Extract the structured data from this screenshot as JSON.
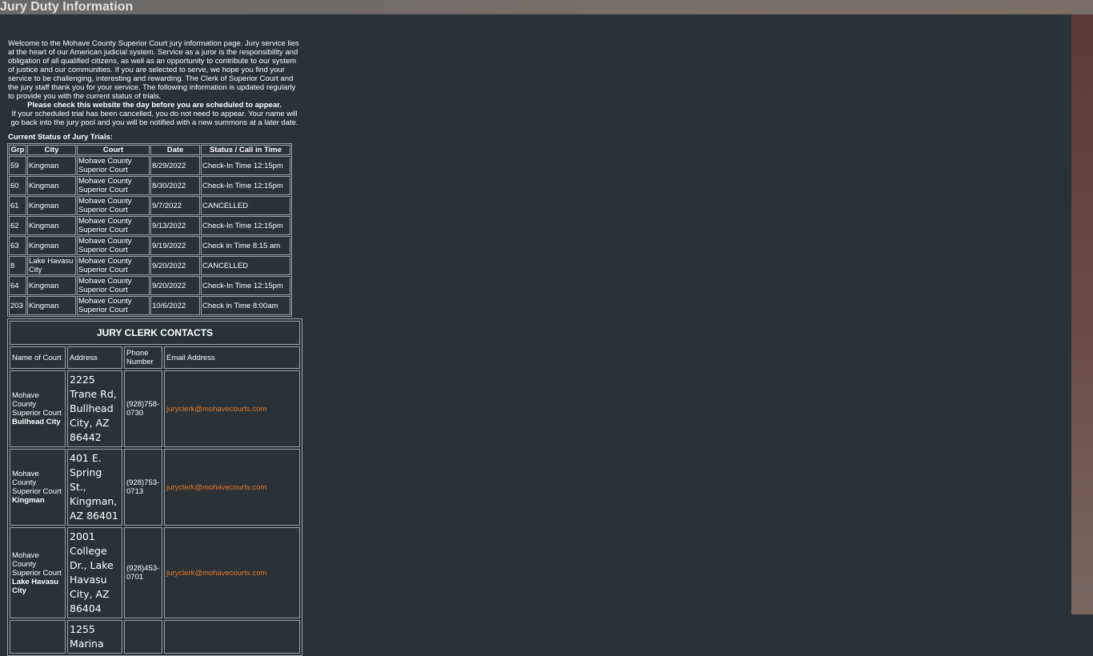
{
  "page": {
    "title": "Jury Duty Information"
  },
  "intro": "Welcome to the Mohave County Superior Court jury information page. Jury service lies at the heart of our American judicial system. Service as a juror is the responsibility and obligation of all qualified citizens, as well as an opportunity to contribute to our system of justice and our communities. If you are selected to serve, we hope you find your service to be challenging, interesting and rewarding. The Clerk of Superior Court and the jury staff thank you for your service. The following information is updated regularly to provide you with the current status of trials.",
  "notice": {
    "bold": "Please check this website the day before you are scheduled to appear.",
    "text": "If your scheduled trial has been cancelled, you do not need to appear. Your name will go back into the jury pool and you will be notified with a new summons at a later date."
  },
  "status_label": "Current Status of Jury Trials:",
  "trials": {
    "headers": [
      "Grp",
      "City",
      "Court",
      "Date",
      "Status / Call in Time"
    ],
    "rows": [
      [
        "59",
        "Kingman",
        "Mohave County Superior Court",
        "8/29/2022",
        "Check-In Time 12:15pm"
      ],
      [
        "60",
        "Kingman",
        "Mohave County Superior Court",
        "8/30/2022",
        "Check-In Time 12:15pm"
      ],
      [
        "61",
        "Kingman",
        "Mohave County Superior Court",
        "9/7/2022",
        "CANCELLED"
      ],
      [
        "62",
        "Kingman",
        "Mohave County Superior Court",
        "9/13/2022",
        "Check-In Time 12:15pm"
      ],
      [
        "63",
        "Kingman",
        "Mohave County Superior Court",
        "9/19/2022",
        "Check in Time 8:15 am"
      ],
      [
        "8",
        "Lake Havasu City",
        "Mohave County Superior Court",
        "9/20/2022",
        "CANCELLED"
      ],
      [
        "64",
        "Kingman",
        "Mohave County Superior Court",
        "9/20/2022",
        "Check-In Time 12:15pm"
      ],
      [
        "203",
        "Kingman",
        "Mohave County Superior Court",
        "10/6/2022",
        "Check in Time 8:00am"
      ]
    ]
  },
  "contacts": {
    "heading": "JURY CLERK CONTACTS",
    "headers": [
      "Name of Court",
      "Address",
      "Phone Number",
      "Email Address"
    ],
    "rows": [
      {
        "court": "Mohave County Superior Court",
        "city": "Bullhead City",
        "address": "2225 Trane Rd, Bullhead City, AZ 86442",
        "phone": "(928)758-0730",
        "email": "juryclerk@mohavecourts.com"
      },
      {
        "court": "Mohave County Superior Court",
        "city": "Kingman",
        "address": "401 E. Spring St., Kingman, AZ 86401",
        "phone": "(928)753-0713",
        "email": "juryclerk@mohavecourts.com"
      },
      {
        "court": "Mohave County Superior Court",
        "city": "Lake Havasu City",
        "address": "2001 College Dr., Lake Havasu City, AZ 86404",
        "phone": "(928)453-0701",
        "email": "juryclerk@mohavecourts.com"
      },
      {
        "court": "",
        "city": "",
        "address": "1255 Marina",
        "phone": "",
        "email": ""
      }
    ]
  },
  "colors": {
    "background": "#2a3237",
    "link": "#e8782a",
    "border": "#9aa3a8"
  }
}
